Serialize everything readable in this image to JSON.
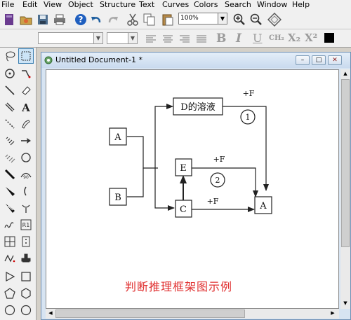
{
  "menu": [
    "File",
    "Edit",
    "View",
    "Object",
    "Structure",
    "Text",
    "Curves",
    "Colors",
    "Search",
    "Window",
    "Help"
  ],
  "toolbar": {
    "zoom_value": "100%",
    "format_labels": [
      "B",
      "I",
      "U",
      "CH₂",
      "X₂",
      "X²"
    ]
  },
  "document": {
    "title": "Untitled Document-1 *",
    "window_buttons": [
      "–",
      "□",
      "✕"
    ]
  },
  "diagram": {
    "boxes": {
      "a_left": "A",
      "b_left": "B",
      "d": "D的溶液",
      "e": "E",
      "c": "C",
      "a_right": "A"
    },
    "labels": {
      "plus_f_top": "+F",
      "plus_f_mid": "+F",
      "plus_f_bottom": "+F",
      "circle_1": "1",
      "circle_2": "2"
    },
    "caption": "判断推理框架图示例"
  },
  "colors": {
    "caption": "#e03030",
    "accent": "#3c7fb1"
  }
}
